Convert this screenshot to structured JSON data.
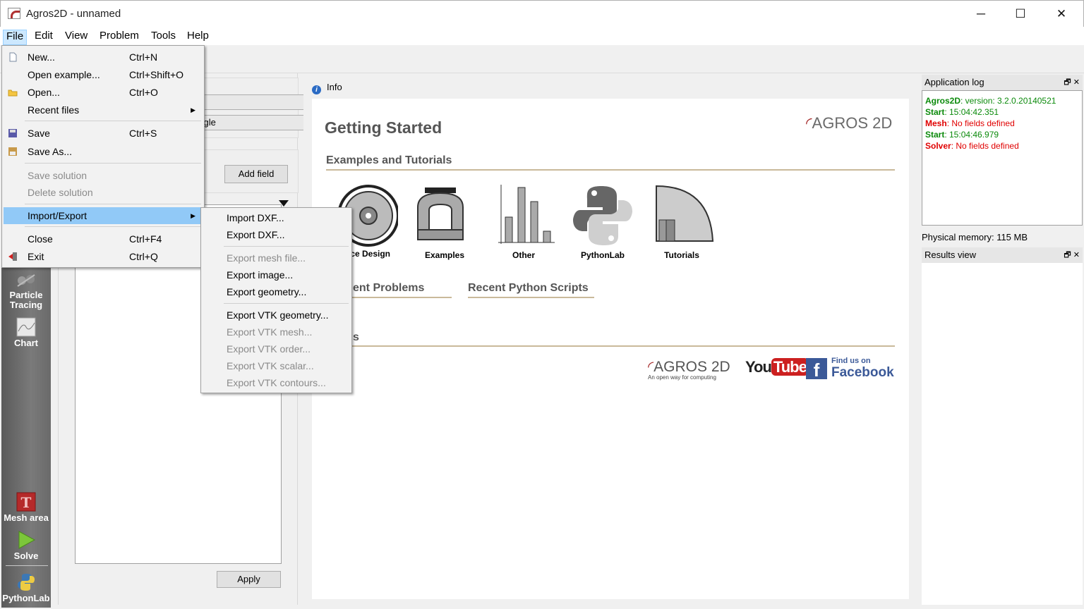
{
  "window": {
    "title": "Agros2D - unnamed",
    "minimize": "─",
    "maximize": "☐",
    "close": "✕"
  },
  "menubar": [
    "File",
    "Edit",
    "View",
    "Problem",
    "Tools",
    "Help"
  ],
  "file_menu": {
    "items": [
      {
        "label": "New...",
        "shortcut": "Ctrl+N",
        "icon": "new-file-icon"
      },
      {
        "label": "Open example...",
        "shortcut": "Ctrl+Shift+O"
      },
      {
        "label": "Open...",
        "shortcut": "Ctrl+O",
        "icon": "folder-icon"
      },
      {
        "label": "Recent files",
        "submenu": true
      },
      {
        "label": "Save",
        "shortcut": "Ctrl+S",
        "icon": "save-icon"
      },
      {
        "label": "Save As...",
        "icon": "save-as-icon"
      },
      {
        "label": "Save solution",
        "disabled": true
      },
      {
        "label": "Delete solution",
        "disabled": true
      },
      {
        "label": "Import/Export",
        "submenu": true,
        "highlighted": true
      },
      {
        "label": "Close",
        "shortcut": "Ctrl+F4"
      },
      {
        "label": "Exit",
        "shortcut": "Ctrl+Q",
        "icon": "exit-icon"
      }
    ],
    "submenu_arrow": "▶"
  },
  "import_export_menu": {
    "items": [
      {
        "label": "Import DXF..."
      },
      {
        "label": "Export DXF..."
      },
      {
        "label": "Export mesh file...",
        "disabled": true
      },
      {
        "label": "Export image..."
      },
      {
        "label": "Export geometry..."
      },
      {
        "label": "Export VTK geometry..."
      },
      {
        "label": "Export VTK mesh...",
        "disabled": true
      },
      {
        "label": "Export VTK order...",
        "disabled": true
      },
      {
        "label": "Export VTK scalar...",
        "disabled": true
      },
      {
        "label": "Export VTK contours...",
        "disabled": true
      }
    ]
  },
  "sidebar": {
    "particle_tracing": "Particle Tracing",
    "chart": "Chart",
    "mesh_area": "Mesh area",
    "solve": "Solve",
    "pythonlab": "PythonLab"
  },
  "left_panel": {
    "combo2_value": "angle",
    "add_field": "Add field",
    "apply": "Apply"
  },
  "info": {
    "dock_title": "Info",
    "heading": "Getting Started",
    "logo": "AGROS 2D",
    "examples_heading": "Examples and Tutorials",
    "tiles": [
      "ice Design",
      "Examples",
      "Other",
      "PythonLab",
      "Tutorials"
    ],
    "recent_problems": "ent Problems",
    "recent_scripts": "Recent Python Scripts",
    "links_fragment": "s",
    "footer_logo": "AGROS 2D",
    "footer_tagline": "An open way for computing",
    "youtube": "YouTube",
    "facebook_small": "Find us on",
    "facebook": "Facebook"
  },
  "app_log": {
    "title": "Application log",
    "lines": [
      {
        "key": "Agros2D",
        "text": ": version: 3.2.0.20140521",
        "color": "#0b8a0b"
      },
      {
        "key": "Start",
        "text": ": 15:04:42.351",
        "color": "#0b8a0b"
      },
      {
        "key": "Mesh",
        "text": ": No fields defined",
        "color": "#e00000"
      },
      {
        "key": "Start",
        "text": ": 15:04:46.979",
        "color": "#0b8a0b"
      },
      {
        "key": "Solver",
        "text": ": No fields defined",
        "color": "#e00000"
      }
    ],
    "dock_buttons": "🗗 ✕"
  },
  "physical_memory": "Physical memory: 115 MB",
  "results_view": {
    "title": "Results view"
  }
}
